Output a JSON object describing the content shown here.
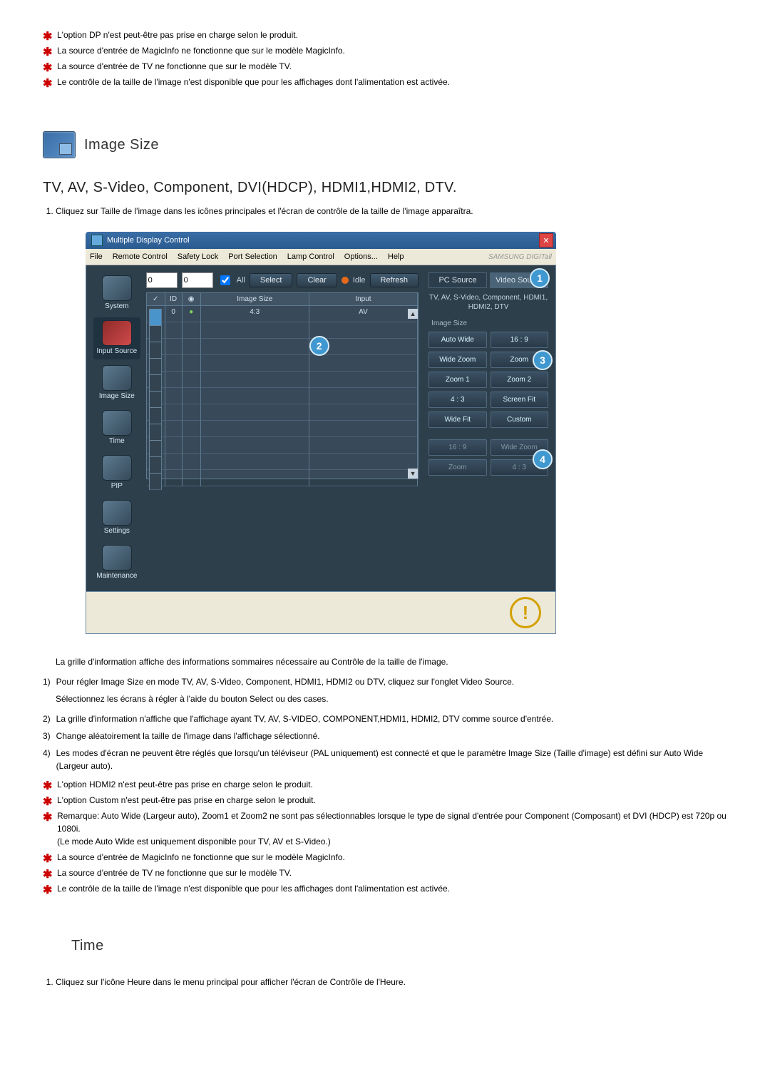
{
  "top_notes": [
    "L'option DP n'est peut-être pas prise en charge selon le produit.",
    "La source d'entrée de MagicInfo ne fonctionne que sur le modèle MagicInfo.",
    "La source d'entrée de TV ne fonctionne que sur le modèle TV.",
    "Le contrôle de la taille de l'image n'est disponible que pour les affichages dont l'alimentation est activée."
  ],
  "section1": {
    "title": "Image Size",
    "subtitle": "TV, AV, S-Video, Component, DVI(HDCP), HDMI1,HDMI2, DTV.",
    "step1": "Cliquez sur Taille de l'image dans les icônes principales et l'écran de contrôle de la taille de l'image apparaîtra."
  },
  "app": {
    "title": "Multiple Display Control",
    "menus": [
      "File",
      "Remote Control",
      "Safety Lock",
      "Port Selection",
      "Lamp Control",
      "Options...",
      "Help"
    ],
    "brand": "SAMSUNG DIGITall",
    "sidebar": [
      "System",
      "Input Source",
      "Image Size",
      "Time",
      "PIP",
      "Settings",
      "Maintenance"
    ],
    "toolbar": {
      "dd1": "0",
      "dd2": "0",
      "all": "All",
      "select": "Select",
      "clear": "Clear",
      "idle": "Idle",
      "refresh": "Refresh"
    },
    "grid": {
      "headers": [
        "",
        "ID",
        "",
        "Image Size",
        "Input"
      ],
      "row1": {
        "id": "0",
        "imgsize": "4:3",
        "input": "AV"
      }
    },
    "panel": {
      "tabs": [
        "PC Source",
        "Video Source"
      ],
      "subtitle": "TV, AV, S-Video, Component, HDMI1, HDMI2, DTV",
      "group": "Image Size",
      "opts": [
        "Auto Wide",
        "16 : 9",
        "Wide Zoom",
        "Zoom",
        "Zoom 1",
        "Zoom 2",
        "4 : 3",
        "Screen Fit",
        "Wide Fit",
        "Custom"
      ],
      "group2_header": "",
      "opts2": [
        "16 : 9",
        "Wide Zoom",
        "Zoom",
        "4 : 3"
      ]
    }
  },
  "after_app": {
    "intro": "La grille d'information affiche des informations sommaires nécessaire au Contrôle de la taille de l'image.",
    "items": [
      {
        "n": "1)",
        "t": "Pour régler Image Size en mode TV, AV, S-Video, Component, HDMI1, HDMI2 ou DTV, cliquez sur l'onglet Video Source."
      },
      {
        "n": "",
        "t": "Sélectionnez les écrans à régler à l'aide du bouton Select ou des cases."
      },
      {
        "n": "2)",
        "t": "La grille d'information n'affiche que l'affichage ayant TV, AV, S-VIDEO, COMPONENT,HDMI1, HDMI2, DTV comme source d'entrée."
      },
      {
        "n": "3)",
        "t": "Change aléatoirement la taille de l'image dans l'affichage sélectionné."
      },
      {
        "n": "4)",
        "t": "Les modes d'écran ne peuvent être réglés que lorsqu'un téléviseur (PAL uniquement) est connecté et que le paramètre Image Size (Taille d'image) est défini sur Auto Wide (Largeur auto)."
      }
    ],
    "stars": [
      "L'option HDMI2 n'est peut-être pas prise en charge selon le produit.",
      "L'option Custom n'est peut-être pas prise en charge selon le produit.",
      "Remarque: Auto Wide (Largeur auto), Zoom1 et Zoom2 ne sont pas sélectionnables lorsque le type de signal d'entrée pour Component (Composant) et DVI (HDCP) est 720p ou 1080i.\n(Le mode Auto Wide est uniquement disponible pour TV, AV et S-Video.)",
      "La source d'entrée de MagicInfo ne fonctionne que sur le modèle MagicInfo.",
      "La source d'entrée de TV ne fonctionne que sur le modèle TV.",
      "Le contrôle de la taille de l'image n'est disponible que pour les affichages dont l'alimentation est activée."
    ]
  },
  "section2": {
    "title": "Time",
    "step1": "Cliquez sur l'icône Heure dans le menu principal pour afficher l'écran de Contrôle de l'Heure."
  }
}
